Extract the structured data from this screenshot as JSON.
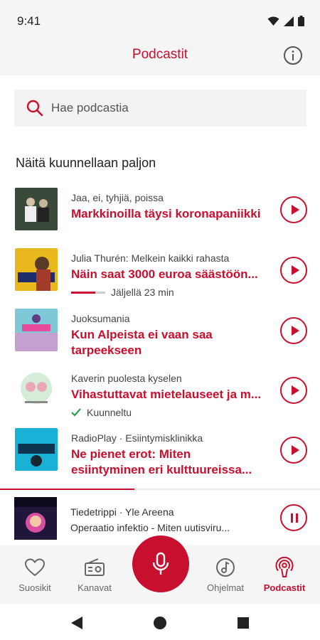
{
  "status": {
    "time": "9:41"
  },
  "header": {
    "title": "Podcastit",
    "info_icon": "info-icon"
  },
  "search": {
    "placeholder": "Hae podcastia",
    "icon": "search-icon"
  },
  "section": {
    "title": "Näitä kuunnellaan paljon"
  },
  "episodes": [
    {
      "show": "Jaa, ei, tyhjiä, poissa",
      "title": "Markkinoilla täysi koronapaniikki",
      "sub": ""
    },
    {
      "show": "Julia Thurén: Melkein kaikki rahasta",
      "title": "Näin saat 3000 euroa säästöön...",
      "sub": "Jäljellä 23 min",
      "progress": 0.7
    },
    {
      "show": "Juoksumania",
      "title": "Kun Alpeista ei vaan saa tarpeekseen",
      "sub": ""
    },
    {
      "show": "Kaverin puolesta kyselen",
      "title": "Vihastuttavat mietelauseet ja m...",
      "sub": "Kuunneltu"
    },
    {
      "show": "RadioPlay · Esiintymisklinikka",
      "title": "Ne pienet erot: Miten esiintyminen eri kulttuureissa...",
      "sub": ""
    }
  ],
  "now_playing": {
    "show": "Tiedetrippi · Yle Areena",
    "episode": "Operaatio infektio - Miten uutisviru...",
    "progress": 0.42
  },
  "nav": {
    "items": [
      {
        "label": "Suosikit",
        "icon": "heart-icon"
      },
      {
        "label": "Kanavat",
        "icon": "radio-icon"
      },
      {
        "label": "Ohjelmat",
        "icon": "music-note-icon"
      },
      {
        "label": "Podcastit",
        "icon": "podcast-icon"
      }
    ],
    "center_icon": "microphone-icon"
  },
  "colors": {
    "accent": "#c8102e",
    "bar_bg": "#f5f5f5"
  }
}
